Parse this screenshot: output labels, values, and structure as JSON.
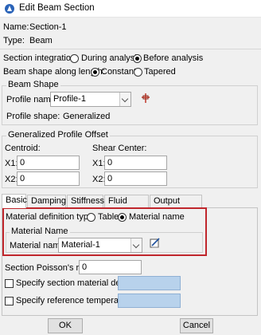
{
  "window": {
    "title": "Edit Beam Section"
  },
  "info": {
    "name_label": "Name:",
    "name_value": "Section-1",
    "type_label": "Type:",
    "type_value": "Beam"
  },
  "section_integration": {
    "label": "Section integration:",
    "options": [
      "During analysis",
      "Before analysis"
    ],
    "selected": "Before analysis"
  },
  "beam_shape_along_length": {
    "label": "Beam shape along length:",
    "options": [
      "Constant",
      "Tapered"
    ],
    "selected": "Constant"
  },
  "beam_shape": {
    "group_title": "Beam Shape",
    "profile_name_label": "Profile name:",
    "profile_name_value": "Profile-1",
    "profile_shape_label": "Profile shape:",
    "profile_shape_value": "Generalized",
    "create_icon": "crosshair-create-icon"
  },
  "profile_offset": {
    "group_title": "Generalized Profile Offset",
    "centroid_label": "Centroid:",
    "shear_center_label": "Shear Center:",
    "centroid": {
      "x1_label": "X1:",
      "x1_value": "0",
      "x2_label": "X2:",
      "x2_value": "0"
    },
    "shear_center": {
      "x1_label": "X1:",
      "x1_value": "0",
      "x2_label": "X2:",
      "x2_value": "0"
    }
  },
  "tabs": [
    {
      "label": "Basic",
      "active": true
    },
    {
      "label": "Damping"
    },
    {
      "label": "Stiffness"
    },
    {
      "label": "Fluid Inertia"
    },
    {
      "label": "Output Points"
    }
  ],
  "basic": {
    "material_definition_type_label": "Material definition type:",
    "material_definition_options": [
      "Table",
      "Material name"
    ],
    "material_definition_selected": "Material name",
    "material_group_title": "Material Name",
    "material_name_label": "Material name:",
    "material_name_value": "Material-1",
    "material_edit_icon": "edit-material-icon",
    "poisson_label": "Section Poisson's ratio:",
    "poisson_value": "0",
    "density_label": "Specify section material density:",
    "density_checked": false,
    "temperature_label": "Specify reference temperature:",
    "temperature_checked": false
  },
  "buttons": {
    "ok": "OK",
    "cancel": "Cancel"
  },
  "colors": {
    "highlight": "#c0262c",
    "disabled_field": "#b8d2ec"
  }
}
